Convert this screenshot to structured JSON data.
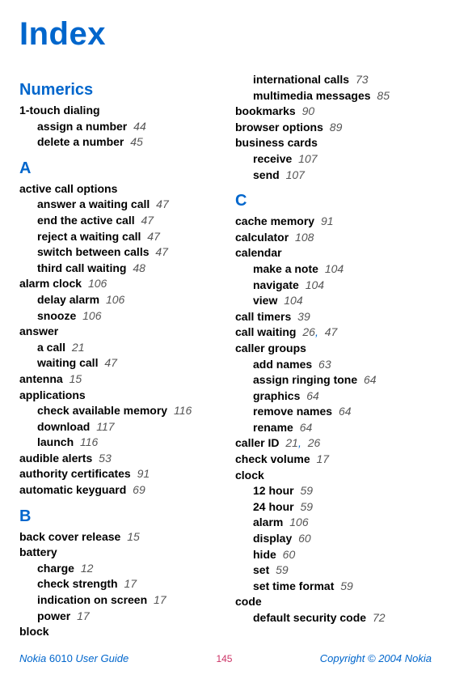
{
  "title": "Index",
  "footer": {
    "product": "Nokia",
    "model": "6010",
    "guide": "User Guide",
    "page": "145",
    "copyright": "Copyright © 2004 Nokia"
  },
  "left": [
    {
      "type": "head",
      "text": "Numerics"
    },
    {
      "type": "top",
      "text": "1-touch dialing"
    },
    {
      "type": "sub",
      "text": "assign a number",
      "pg": "44"
    },
    {
      "type": "sub",
      "text": "delete a number",
      "pg": "45"
    },
    {
      "type": "head",
      "text": "A"
    },
    {
      "type": "top",
      "text": "active call options"
    },
    {
      "type": "sub",
      "text": "answer a waiting call",
      "pg": "47"
    },
    {
      "type": "sub",
      "text": "end the active call",
      "pg": "47"
    },
    {
      "type": "sub",
      "text": "reject a waiting call",
      "pg": "47"
    },
    {
      "type": "sub",
      "text": "switch between calls",
      "pg": "47"
    },
    {
      "type": "sub",
      "text": "third call waiting",
      "pg": "48"
    },
    {
      "type": "top",
      "text": "alarm clock",
      "pg": "106"
    },
    {
      "type": "sub",
      "text": "delay alarm",
      "pg": "106"
    },
    {
      "type": "sub",
      "text": "snooze",
      "pg": "106"
    },
    {
      "type": "top",
      "text": "answer"
    },
    {
      "type": "sub",
      "text": "a call",
      "pg": "21"
    },
    {
      "type": "sub",
      "text": "waiting call",
      "pg": "47"
    },
    {
      "type": "top",
      "text": "antenna",
      "pg": "15"
    },
    {
      "type": "top",
      "text": "applications"
    },
    {
      "type": "sub",
      "text": "check available memory",
      "pg": "116"
    },
    {
      "type": "sub",
      "text": "download",
      "pg": "117"
    },
    {
      "type": "sub",
      "text": "launch",
      "pg": "116"
    },
    {
      "type": "top",
      "text": "audible alerts",
      "pg": "53"
    },
    {
      "type": "top",
      "text": "authority certificates",
      "pg": "91"
    },
    {
      "type": "top",
      "text": "automatic keyguard",
      "pg": "69"
    },
    {
      "type": "head",
      "text": "B"
    },
    {
      "type": "top",
      "text": "back cover release",
      "pg": "15"
    },
    {
      "type": "top",
      "text": "battery"
    },
    {
      "type": "sub",
      "text": "charge",
      "pg": "12"
    },
    {
      "type": "sub",
      "text": "check strength",
      "pg": "17"
    },
    {
      "type": "sub",
      "text": "indication on screen",
      "pg": "17"
    },
    {
      "type": "sub",
      "text": "power",
      "pg": "17"
    },
    {
      "type": "top",
      "text": "block"
    }
  ],
  "right": [
    {
      "type": "sub",
      "text": "international calls",
      "pg": "73"
    },
    {
      "type": "sub",
      "text": "multimedia messages",
      "pg": "85"
    },
    {
      "type": "top",
      "text": "bookmarks",
      "pg": "90"
    },
    {
      "type": "top",
      "text": "browser options",
      "pg": "89"
    },
    {
      "type": "top",
      "text": "business cards"
    },
    {
      "type": "sub",
      "text": "receive",
      "pg": "107"
    },
    {
      "type": "sub",
      "text": "send",
      "pg": "107"
    },
    {
      "type": "head",
      "text": "C"
    },
    {
      "type": "top",
      "text": "cache memory",
      "pg": "91"
    },
    {
      "type": "top",
      "text": "calculator",
      "pg": "108"
    },
    {
      "type": "top",
      "text": "calendar"
    },
    {
      "type": "sub",
      "text": "make a note",
      "pg": "104"
    },
    {
      "type": "sub",
      "text": "navigate",
      "pg": "104"
    },
    {
      "type": "sub",
      "text": "view",
      "pg": "104"
    },
    {
      "type": "top",
      "text": "call timers",
      "pg": "39"
    },
    {
      "type": "top",
      "text": "call waiting",
      "pg": "26",
      "pg2": "47"
    },
    {
      "type": "top",
      "text": "caller groups"
    },
    {
      "type": "sub",
      "text": "add names",
      "pg": "63"
    },
    {
      "type": "sub",
      "text": "assign ringing tone",
      "pg": "64"
    },
    {
      "type": "sub",
      "text": "graphics",
      "pg": "64"
    },
    {
      "type": "sub",
      "text": "remove names",
      "pg": "64"
    },
    {
      "type": "sub",
      "text": "rename",
      "pg": "64"
    },
    {
      "type": "top",
      "text": "caller ID",
      "pg": "21",
      "pg2": "26"
    },
    {
      "type": "top",
      "text": "check volume",
      "pg": "17"
    },
    {
      "type": "top",
      "text": "clock"
    },
    {
      "type": "sub",
      "text": "12 hour",
      "pg": "59"
    },
    {
      "type": "sub",
      "text": "24 hour",
      "pg": "59"
    },
    {
      "type": "sub",
      "text": "alarm",
      "pg": "106"
    },
    {
      "type": "sub",
      "text": "display",
      "pg": "60"
    },
    {
      "type": "sub",
      "text": "hide",
      "pg": "60"
    },
    {
      "type": "sub",
      "text": "set",
      "pg": "59"
    },
    {
      "type": "sub",
      "text": "set time format",
      "pg": "59"
    },
    {
      "type": "top",
      "text": "code"
    },
    {
      "type": "sub",
      "text": "default security code",
      "pg": "72"
    }
  ]
}
